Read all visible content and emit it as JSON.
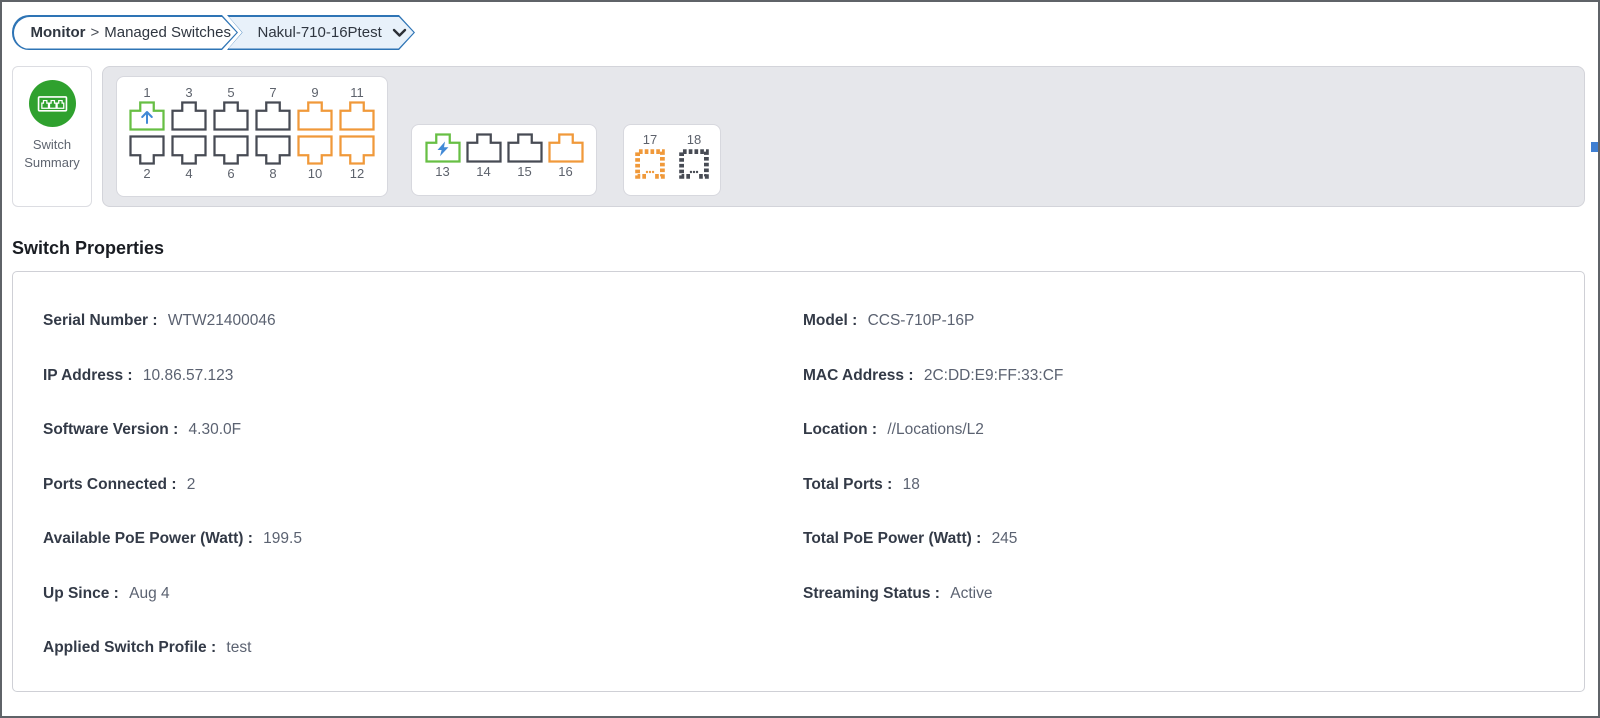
{
  "breadcrumb": {
    "section_label": "Monitor",
    "separator": ">",
    "parent_label": "Managed Switches",
    "device_label": "Nakul-710-16Ptest"
  },
  "summary_card": {
    "line1": "Switch",
    "line2": "Summary"
  },
  "colors": {
    "accent_blue": "#2e74b5",
    "device_crumb_fill": "#e8f1fa",
    "summary_circle_green": "#2fa12e",
    "port_connected_green": "#67bf44",
    "port_default_gray": "#474b54",
    "port_warning_orange": "#f0993a",
    "port_overlay_blue": "#4189d6",
    "panel_gray": "#e6e7eb"
  },
  "ports": {
    "group1": {
      "top": [
        {
          "num": "1",
          "state": "uplink",
          "icon": "arrow-up"
        },
        {
          "num": "3",
          "state": "default"
        },
        {
          "num": "5",
          "state": "default"
        },
        {
          "num": "7",
          "state": "default"
        },
        {
          "num": "9",
          "state": "warning"
        },
        {
          "num": "11",
          "state": "warning"
        }
      ],
      "bottom": [
        {
          "num": "2",
          "state": "default"
        },
        {
          "num": "4",
          "state": "default"
        },
        {
          "num": "6",
          "state": "default"
        },
        {
          "num": "8",
          "state": "default"
        },
        {
          "num": "10",
          "state": "warning"
        },
        {
          "num": "12",
          "state": "warning"
        }
      ]
    },
    "group2": [
      {
        "num": "13",
        "state": "poe",
        "icon": "lightning-bolt"
      },
      {
        "num": "14",
        "state": "default"
      },
      {
        "num": "15",
        "state": "default"
      },
      {
        "num": "16",
        "state": "warning"
      }
    ],
    "group3": [
      {
        "num": "17",
        "state": "warning"
      },
      {
        "num": "18",
        "state": "default"
      }
    ]
  },
  "section": {
    "title": "Switch Properties"
  },
  "properties": {
    "separator": " : ",
    "left": [
      {
        "label": "Serial Number",
        "value": "WTW21400046"
      },
      {
        "label": "IP Address",
        "value": "10.86.57.123"
      },
      {
        "label": "Software Version",
        "value": "4.30.0F"
      },
      {
        "label": "Ports Connected",
        "value": "2"
      },
      {
        "label": "Available PoE Power (Watt)",
        "value": "199.5"
      },
      {
        "label": "Up Since",
        "value": "Aug 4"
      },
      {
        "label": "Applied Switch Profile",
        "value": "test"
      }
    ],
    "right": [
      {
        "label": "Model",
        "value": "CCS-710P-16P"
      },
      {
        "label": "MAC Address",
        "value": "2C:DD:E9:FF:33:CF"
      },
      {
        "label": "Location",
        "value": "//Locations/L2"
      },
      {
        "label": "Total Ports",
        "value": "18"
      },
      {
        "label": "Total PoE Power (Watt)",
        "value": "245"
      },
      {
        "label": "Streaming Status",
        "value": "Active"
      }
    ]
  }
}
